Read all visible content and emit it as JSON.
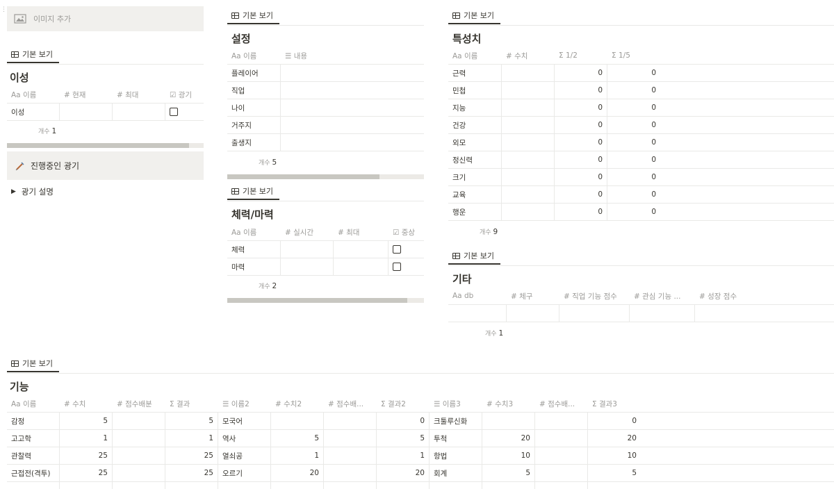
{
  "left": {
    "add_image": "이미지 추가",
    "view_label": "기본 보기",
    "title": "이성",
    "headers": [
      "Aa 이름",
      "# 현재",
      "# 최대",
      "☑ 광기"
    ],
    "rows": [
      {
        "name": "이성"
      }
    ],
    "count_label": "개수",
    "count": "1",
    "callout": "진행중인 광기",
    "toggle": "광기 설명"
  },
  "settings": {
    "view_label": "기본 보기",
    "title": "설정",
    "headers": [
      "Aa 이름",
      "☰ 내용"
    ],
    "rows": [
      "플레이어",
      "직업",
      "나이",
      "거주지",
      "출생지"
    ],
    "count_label": "개수",
    "count": "5"
  },
  "hpmp": {
    "view_label": "기본 보기",
    "title": "체력/마력",
    "headers": [
      "Aa 이름",
      "# 실시간",
      "# 최대",
      "☑ 중상"
    ],
    "rows": [
      "체력",
      "마력"
    ],
    "count_label": "개수",
    "count": "2"
  },
  "traits": {
    "view_label": "기본 보기",
    "title": "특성치",
    "headers": [
      "Aa 이름",
      "# 수치",
      "Σ 1/2",
      "Σ 1/5"
    ],
    "rows": [
      {
        "name": "근력",
        "half": "0",
        "fifth": "0"
      },
      {
        "name": "민첩",
        "half": "0",
        "fifth": "0"
      },
      {
        "name": "지능",
        "half": "0",
        "fifth": "0"
      },
      {
        "name": "건강",
        "half": "0",
        "fifth": "0"
      },
      {
        "name": "외모",
        "half": "0",
        "fifth": "0"
      },
      {
        "name": "정신력",
        "half": "0",
        "fifth": "0"
      },
      {
        "name": "크기",
        "half": "0",
        "fifth": "0"
      },
      {
        "name": "교육",
        "half": "0",
        "fifth": "0"
      },
      {
        "name": "행운",
        "half": "0",
        "fifth": "0"
      }
    ],
    "count_label": "개수",
    "count": "9"
  },
  "etc": {
    "view_label": "기본 보기",
    "title": "기타",
    "headers": [
      "Aa db",
      "# 체구",
      "# 직업 기능 점수",
      "# 관심 기능 ...",
      "# 성장 점수"
    ],
    "count_label": "개수",
    "count": "1"
  },
  "skills": {
    "view_label": "기본 보기",
    "title": "기능",
    "headers": [
      "Aa 이름",
      "# 수치",
      "# 점수배분",
      "Σ 결과",
      "☰ 이름2",
      "# 수치2",
      "# 점수배...",
      "Σ 결과2",
      "☰ 이름3",
      "# 수치3",
      "# 점수배...",
      "Σ 결과3"
    ],
    "rows": [
      [
        "감정",
        "5",
        "",
        "5",
        "모국어",
        "",
        "",
        "0",
        "크툴루신화",
        "",
        "",
        "0"
      ],
      [
        "고고학",
        "1",
        "",
        "1",
        "역사",
        "5",
        "",
        "5",
        "투척",
        "20",
        "",
        "20"
      ],
      [
        "관찰력",
        "25",
        "",
        "25",
        "열쇠공",
        "1",
        "",
        "1",
        "항법",
        "10",
        "",
        "10"
      ],
      [
        "근접전(격투)",
        "25",
        "",
        "25",
        "오르기",
        "20",
        "",
        "20",
        "회계",
        "5",
        "",
        "5"
      ],
      [
        "",
        "",
        "",
        "",
        "",
        "",
        "",
        "",
        "",
        "",
        "",
        ""
      ]
    ]
  }
}
